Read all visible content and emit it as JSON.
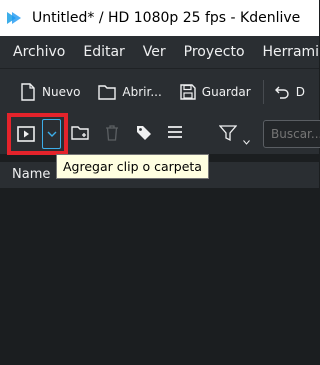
{
  "window": {
    "title": "Untitled* / HD 1080p 25 fps - Kdenlive"
  },
  "menubar": {
    "items": [
      "Archivo",
      "Editar",
      "Ver",
      "Proyecto",
      "Herramie"
    ]
  },
  "toolbar": {
    "new_label": "Nuevo",
    "open_label": "Abrir...",
    "save_label": "Guardar",
    "undo_label": "D"
  },
  "bin_toolbar": {
    "search_placeholder": "Buscar..."
  },
  "bin": {
    "column_name": "Name"
  },
  "tooltip": {
    "text": "Agregar clip o carpeta"
  },
  "colors": {
    "highlight": "#e4232b",
    "accent": "#3daee9"
  }
}
